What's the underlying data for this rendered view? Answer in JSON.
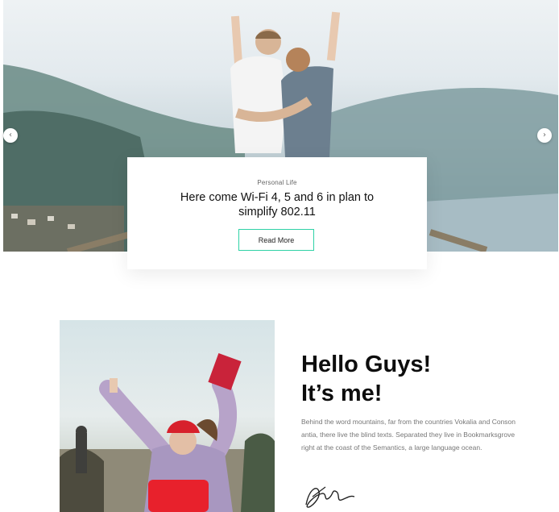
{
  "slider": {
    "prev_icon": "‹",
    "next_icon": "›",
    "category": "Personal Life",
    "title": "Here come Wi-Fi 4, 5 and 6 in plan to simplify 802.11",
    "button_label": "Read More",
    "accent_color": "#2fd2a6"
  },
  "about": {
    "heading_line1": "Hello Guys!",
    "heading_line2": "It’s me!",
    "bio": "Behind the word mountains, far from the countries Vokalia and Conson antia, there live the blind texts. Separated they live in Bookmarksgrove right at the coast of the Semantics, a large language ocean."
  }
}
